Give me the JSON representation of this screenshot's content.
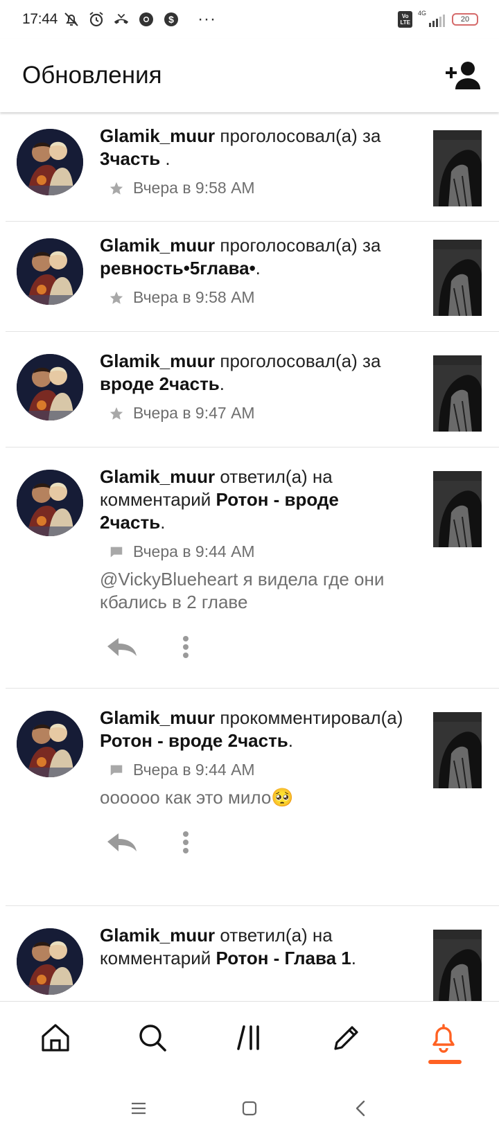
{
  "status_bar": {
    "time": "17:44",
    "icons": [
      "bell-off-icon",
      "alarm-icon",
      "missed-call-icon",
      "chrome-icon",
      "dollar-app-icon"
    ],
    "overflow": "···",
    "volte": "Vo\nLTE",
    "network": "4G",
    "battery": "20",
    "battery_color": "#d56a6a"
  },
  "header": {
    "title": "Обновления",
    "action_icon": "add-friend-icon"
  },
  "accent_color": "#ff6122",
  "feed": [
    {
      "user": "Glamik_muur",
      "action": " проголосовал(а) за ",
      "story": "3часть",
      "suffix": " .",
      "time_icon": "star-icon",
      "time": "Вчера в 9:58 AM"
    },
    {
      "user": "Glamik_muur",
      "action": " проголосовал(а) за ",
      "story": "ревность•5глава•",
      "suffix": ".",
      "time_icon": "star-icon",
      "time": "Вчера в 9:58 AM"
    },
    {
      "user": "Glamik_muur",
      "action": " проголосовал(а) за ",
      "story": "вроде 2часть",
      "suffix": ".",
      "time_icon": "star-icon",
      "time": "Вчера в 9:47 AM"
    },
    {
      "user": "Glamik_muur",
      "action": " ответил(а) на комментарий ",
      "story": "Ротон - вроде 2часть",
      "suffix": ".",
      "time_icon": "comment-icon",
      "time": "Вчера в 9:44 AM",
      "comment": "@VickyBlueheart я видела где они кбались в 2 главе"
    },
    {
      "user": "Glamik_muur",
      "action": " прокомментировал(а) ",
      "story": "Ротон - вроде 2часть",
      "suffix": ".",
      "time_icon": "comment-icon",
      "time": "Вчера в 9:44 AM",
      "comment": "оооооо как это мило🥺"
    },
    {
      "user": "Glamik_muur",
      "action": " ответил(а) на комментарий ",
      "story": "Ротон - Глава 1",
      "suffix": ".",
      "time_icon": "comment-icon",
      "time": ""
    }
  ],
  "bottom_nav": [
    {
      "icon": "home-icon",
      "active": false
    },
    {
      "icon": "search-icon",
      "active": false
    },
    {
      "icon": "library-icon",
      "active": false
    },
    {
      "icon": "write-icon",
      "active": false
    },
    {
      "icon": "notifications-icon",
      "active": true
    }
  ],
  "system_nav": [
    "recent-apps-icon",
    "home-button-icon",
    "back-icon"
  ]
}
